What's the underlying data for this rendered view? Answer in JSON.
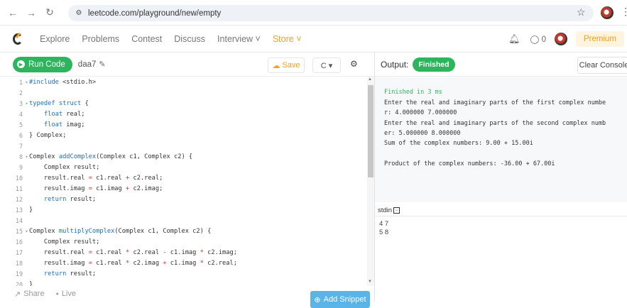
{
  "browser": {
    "url": "leetcode.com/playground/new/empty"
  },
  "nav": {
    "links": [
      "Explore",
      "Problems",
      "Contest",
      "Discuss",
      "Interview ˅"
    ],
    "store": "Store ˅",
    "coins": "0",
    "premium": "Premium"
  },
  "editor_toolbar": {
    "run_label": "Run Code",
    "filename": "daa7",
    "save_label": "Save",
    "language": "C ▾"
  },
  "code": {
    "lines": [
      {
        "n": "1",
        "fold": "▾",
        "text": "#include <stdio.h>"
      },
      {
        "n": "2",
        "fold": "",
        "text": ""
      },
      {
        "n": "3",
        "fold": "▾",
        "text": "typedef struct {"
      },
      {
        "n": "4",
        "fold": "",
        "text": "    float real;"
      },
      {
        "n": "5",
        "fold": "",
        "text": "    float imag;"
      },
      {
        "n": "6",
        "fold": "",
        "text": "} Complex;"
      },
      {
        "n": "7",
        "fold": "",
        "text": ""
      },
      {
        "n": "8",
        "fold": "▾",
        "text": "Complex addComplex(Complex c1, Complex c2) {"
      },
      {
        "n": "9",
        "fold": "",
        "text": "    Complex result;"
      },
      {
        "n": "10",
        "fold": "",
        "text": "    result.real = c1.real + c2.real;"
      },
      {
        "n": "11",
        "fold": "",
        "text": "    result.imag = c1.imag + c2.imag;"
      },
      {
        "n": "12",
        "fold": "",
        "text": "    return result;"
      },
      {
        "n": "13",
        "fold": "",
        "text": "}"
      },
      {
        "n": "14",
        "fold": "",
        "text": ""
      },
      {
        "n": "15",
        "fold": "▾",
        "text": "Complex multiplyComplex(Complex c1, Complex c2) {"
      },
      {
        "n": "16",
        "fold": "",
        "text": "    Complex result;"
      },
      {
        "n": "17",
        "fold": "",
        "text": "    result.real = c1.real * c2.real - c1.imag * c2.imag;"
      },
      {
        "n": "18",
        "fold": "",
        "text": "    result.imag = c1.real * c2.imag + c1.imag * c2.real;"
      },
      {
        "n": "19",
        "fold": "",
        "text": "    return result;"
      },
      {
        "n": "20",
        "fold": "",
        "text": "}"
      }
    ]
  },
  "editor_bottom": {
    "share_label": "Share",
    "live_label": "Live",
    "add_snippet_label": "Add Snippet"
  },
  "output": {
    "label": "Output:",
    "status": "Finished",
    "clear_label": "Clear Console",
    "lines": [
      {
        "text": "Finished in 3 ms",
        "kind": "ok"
      },
      {
        "text": "Enter the real and imaginary parts of the first complex numbe",
        "kind": "out"
      },
      {
        "text": "r: 4.000000 7.000000",
        "kind": "out"
      },
      {
        "text": "Enter the real and imaginary parts of the second complex numb",
        "kind": "out"
      },
      {
        "text": "er: 5.000000 8.000000",
        "kind": "out"
      },
      {
        "text": "Sum of the complex numbers: 9.00 + 15.00i",
        "kind": "out"
      },
      {
        "text": "",
        "kind": "out"
      },
      {
        "text": "Product of the complex numbers: -36.00 + 67.00i",
        "kind": "out"
      }
    ]
  },
  "stdin": {
    "label": "stdin",
    "lines": [
      "4 7",
      "5 8"
    ]
  },
  "colors": {
    "green": "#2db55d",
    "orange": "#f89f1b",
    "keyword": "#1b6ec2",
    "function": "#1b6ec2",
    "blue_button": "#5ab4e8"
  }
}
